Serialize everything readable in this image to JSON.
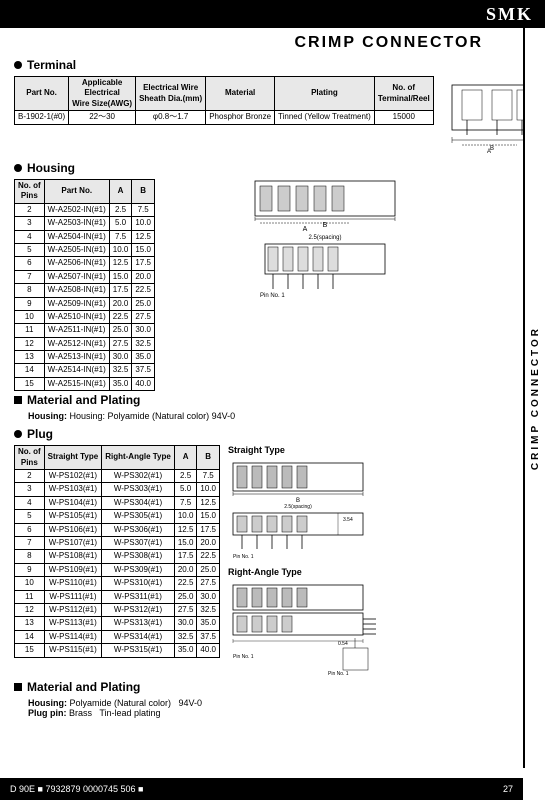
{
  "header": {
    "brand": "SMK",
    "title": "CRIMP CONNECTOR"
  },
  "sidebar": {
    "text": "CRIMP CONNECTOR"
  },
  "terminal": {
    "section_label": "Terminal",
    "table_headers": [
      "Part No.",
      "Applicable Electrical Wire Size(AWG)",
      "Electrical Wire Sheath Dia.(mm)",
      "Material",
      "Plating",
      "No. of Terminal/Reel"
    ],
    "rows": [
      [
        "B-1902-1(#0)",
        "22～30",
        "φ0.8～1.7",
        "Phosphor Bronze",
        "Tinned (Yellow Treatment)",
        "15000"
      ]
    ]
  },
  "housing": {
    "section_label": "Housing",
    "table_headers": [
      "No. of Pins",
      "Part No.",
      "A",
      "B"
    ],
    "rows": [
      [
        "2",
        "W-A2502-IN(#1)",
        "2.5",
        "7.5"
      ],
      [
        "3",
        "W-A2503-IN(#1)",
        "5.0",
        "10.0"
      ],
      [
        "4",
        "W-A2504-IN(#1)",
        "7.5",
        "12.5"
      ],
      [
        "5",
        "W-A2505-IN(#1)",
        "10.0",
        "15.0"
      ],
      [
        "6",
        "W-A2506-IN(#1)",
        "12.5",
        "17.5"
      ],
      [
        "7",
        "W-A2507-IN(#1)",
        "15.0",
        "20.0"
      ],
      [
        "8",
        "W-A2508-IN(#1)",
        "17.5",
        "22.5"
      ],
      [
        "9",
        "W-A2509-IN(#1)",
        "20.0",
        "25.0"
      ],
      [
        "10",
        "W-A2510-IN(#1)",
        "22.5",
        "27.5"
      ],
      [
        "11",
        "W-A2511-IN(#1)",
        "25.0",
        "30.0"
      ],
      [
        "12",
        "W-A2512-IN(#1)",
        "27.5",
        "32.5"
      ],
      [
        "13",
        "W-A2513-IN(#1)",
        "30.0",
        "35.0"
      ],
      [
        "14",
        "W-A2514-IN(#1)",
        "32.5",
        "37.5"
      ],
      [
        "15",
        "W-A2515-IN(#1)",
        "35.0",
        "40.0"
      ]
    ],
    "material_label": "Material and Plating",
    "material_note": "Housing: Polyamide (Natural color)  94V-0"
  },
  "plug": {
    "section_label": "Plug",
    "table_headers": [
      "No. of Pins",
      "Straight Type",
      "Right-Angle Type",
      "A",
      "B"
    ],
    "rows": [
      [
        "2",
        "W-PS102(#1)",
        "W-PS302(#1)",
        "2.5",
        "7.5"
      ],
      [
        "3",
        "W-PS103(#1)",
        "W-PS303(#1)",
        "5.0",
        "10.0"
      ],
      [
        "4",
        "W-PS104(#1)",
        "W-PS304(#1)",
        "7.5",
        "12.5"
      ],
      [
        "5",
        "W-PS105(#1)",
        "W-PS305(#1)",
        "10.0",
        "15.0"
      ],
      [
        "6",
        "W-PS106(#1)",
        "W-PS306(#1)",
        "12.5",
        "17.5"
      ],
      [
        "7",
        "W-PS107(#1)",
        "W-PS307(#1)",
        "15.0",
        "20.0"
      ],
      [
        "8",
        "W-PS108(#1)",
        "W-PS308(#1)",
        "17.5",
        "22.5"
      ],
      [
        "9",
        "W-PS109(#1)",
        "W-PS309(#1)",
        "20.0",
        "25.0"
      ],
      [
        "10",
        "W-PS110(#1)",
        "W-PS310(#1)",
        "22.5",
        "27.5"
      ],
      [
        "11",
        "W-PS111(#1)",
        "W-PS311(#1)",
        "25.0",
        "30.0"
      ],
      [
        "12",
        "W-PS112(#1)",
        "W-PS312(#1)",
        "27.5",
        "32.5"
      ],
      [
        "13",
        "W-PS113(#1)",
        "W-PS313(#1)",
        "30.0",
        "35.0"
      ],
      [
        "14",
        "W-PS114(#1)",
        "W-PS314(#1)",
        "32.5",
        "37.5"
      ],
      [
        "15",
        "W-PS115(#1)",
        "W-PS315(#1)",
        "35.0",
        "40.0"
      ]
    ],
    "material_label": "Material and Plating",
    "material_notes": [
      "Housing: Polyamide (Natural color)  94V-0",
      "Plug pin: Brass  Tin-lead plating"
    ],
    "straight_type_label": "Straight Type",
    "right_angle_type_label": "Right-Angle Type"
  },
  "footer": {
    "left": "D  90E ■ 7932879  0000745 506 ■",
    "right": "27"
  }
}
